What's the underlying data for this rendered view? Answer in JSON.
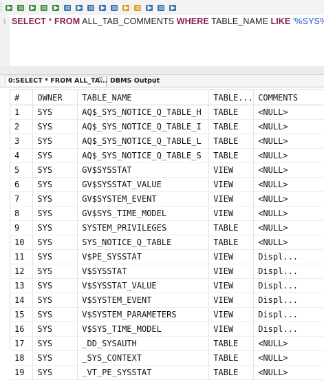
{
  "toolbar": {
    "buttons": [
      {
        "icon": "execute-statement-icon",
        "color": "#3f8b3b"
      },
      {
        "icon": "execute-script-icon",
        "color": "#3f8b3b"
      },
      {
        "icon": "run-all-icon",
        "color": "#3f8b3b"
      },
      {
        "icon": "run-sql-icon",
        "color": "#3f8b3b"
      },
      {
        "icon": "explain-plan-icon",
        "color": "#3f8b3b"
      },
      {
        "icon": "grid-view-icon",
        "color": "#3a6fb0"
      },
      {
        "icon": "text-view-icon",
        "color": "#3a6fb0"
      },
      {
        "icon": "save-result-icon",
        "color": "#3a6fb0"
      },
      {
        "icon": "table-icon",
        "color": "#3a6fb0"
      },
      {
        "icon": "format-icon",
        "color": "#3a6fb0"
      },
      {
        "icon": "arrow-up-icon",
        "color": "#e09b25"
      },
      {
        "icon": "arrow-down-icon",
        "color": "#e09b25"
      },
      {
        "icon": "export-icon",
        "color": "#3a6fb0"
      },
      {
        "icon": "settings-icon",
        "color": "#3a6fb0"
      },
      {
        "icon": "history-icon",
        "color": "#3a6fb0"
      }
    ]
  },
  "editor": {
    "line_number": "1",
    "sql": {
      "kw_select": "SELECT",
      "star": "*",
      "kw_from": "FROM",
      "table": "ALL_TAB_COMMENTS",
      "kw_where": "WHERE",
      "column": "TABLE_NAME",
      "kw_like": "LIKE",
      "pattern": "'%SYS%';"
    }
  },
  "results": {
    "tabs": [
      {
        "label": "0:SELECT * FROM ALL_TA...",
        "close": "⊠",
        "active": true
      },
      {
        "label": "DBMS Output",
        "active": false
      }
    ],
    "columns": [
      "#",
      "OWNER",
      "TABLE_NAME",
      "TABLE...",
      "COMMENTS"
    ],
    "rows": [
      [
        "1",
        "SYS",
        "AQ$_SYS_NOTICE_Q_TABLE_H",
        "TABLE",
        "<NULL>"
      ],
      [
        "2",
        "SYS",
        "AQ$_SYS_NOTICE_Q_TABLE_I",
        "TABLE",
        "<NULL>"
      ],
      [
        "3",
        "SYS",
        "AQ$_SYS_NOTICE_Q_TABLE_L",
        "TABLE",
        "<NULL>"
      ],
      [
        "4",
        "SYS",
        "AQ$_SYS_NOTICE_Q_TABLE_S",
        "TABLE",
        "<NULL>"
      ],
      [
        "5",
        "SYS",
        "GV$SYSSTAT",
        "VIEW",
        "<NULL>"
      ],
      [
        "6",
        "SYS",
        "GV$SYSSTAT_VALUE",
        "VIEW",
        "<NULL>"
      ],
      [
        "7",
        "SYS",
        "GV$SYSTEM_EVENT",
        "VIEW",
        "<NULL>"
      ],
      [
        "8",
        "SYS",
        "GV$SYS_TIME_MODEL",
        "VIEW",
        "<NULL>"
      ],
      [
        "9",
        "SYS",
        "SYSTEM_PRIVILEGES",
        "TABLE",
        "<NULL>"
      ],
      [
        "10",
        "SYS",
        "SYS_NOTICE_Q_TABLE",
        "TABLE",
        "<NULL>"
      ],
      [
        "11",
        "SYS",
        "V$PE_SYSSTAT",
        "VIEW",
        "Displ..."
      ],
      [
        "12",
        "SYS",
        "V$SYSSTAT",
        "VIEW",
        "Displ..."
      ],
      [
        "13",
        "SYS",
        "V$SYSSTAT_VALUE",
        "VIEW",
        "Displ..."
      ],
      [
        "14",
        "SYS",
        "V$SYSTEM_EVENT",
        "VIEW",
        "Displ..."
      ],
      [
        "15",
        "SYS",
        "V$SYSTEM_PARAMETERS",
        "VIEW",
        "Displ..."
      ],
      [
        "16",
        "SYS",
        "V$SYS_TIME_MODEL",
        "VIEW",
        "Displ..."
      ],
      [
        "17",
        "SYS",
        "_DD_SYSAUTH",
        "TABLE",
        "<NULL>"
      ],
      [
        "18",
        "SYS",
        "_SYS_CONTEXT",
        "TABLE",
        "<NULL>"
      ],
      [
        "19",
        "SYS",
        "_VT_PE_SYSSTAT",
        "TABLE",
        "<NULL>"
      ]
    ]
  }
}
